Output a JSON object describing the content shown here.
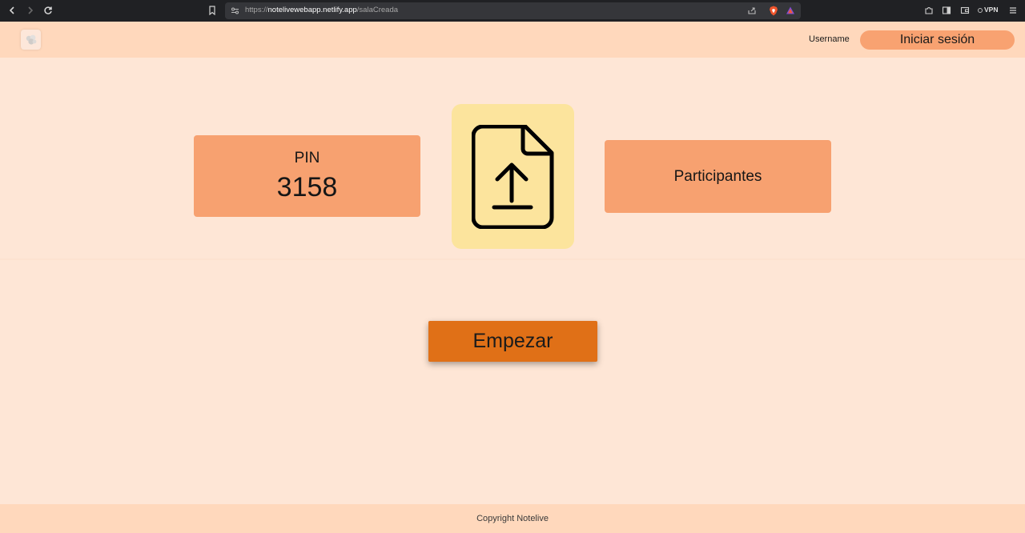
{
  "browser": {
    "url_prefix": "https://",
    "url_host": "notelivewebapp.netlify.app",
    "url_path": "/salaCreada",
    "vpn_label": "VPN",
    "icons": [
      "back-icon",
      "forward-icon",
      "reload-icon",
      "bookmark-icon",
      "site-info-icon",
      "share-icon",
      "brave-shield-icon",
      "brave-rewards-icon",
      "extensions-icon",
      "sidebar-icon",
      "wallet-icon",
      "vpn-icon",
      "menu-icon"
    ]
  },
  "header": {
    "logo_icon": "notelive-logo-icon",
    "username": "Username",
    "login_label": "Iniciar sesión"
  },
  "main": {
    "pin_label": "PIN",
    "pin_value": "3158",
    "upload_icon": "file-upload-icon",
    "participants_label": "Participantes",
    "start_label": "Empezar"
  },
  "footer": {
    "copyright": "Copyright Notelive"
  },
  "colors": {
    "background": "#fee6d6",
    "header": "#ffd8bc",
    "card": "#f7a170",
    "upload_card": "#fce49d",
    "start_button": "#e07017"
  }
}
